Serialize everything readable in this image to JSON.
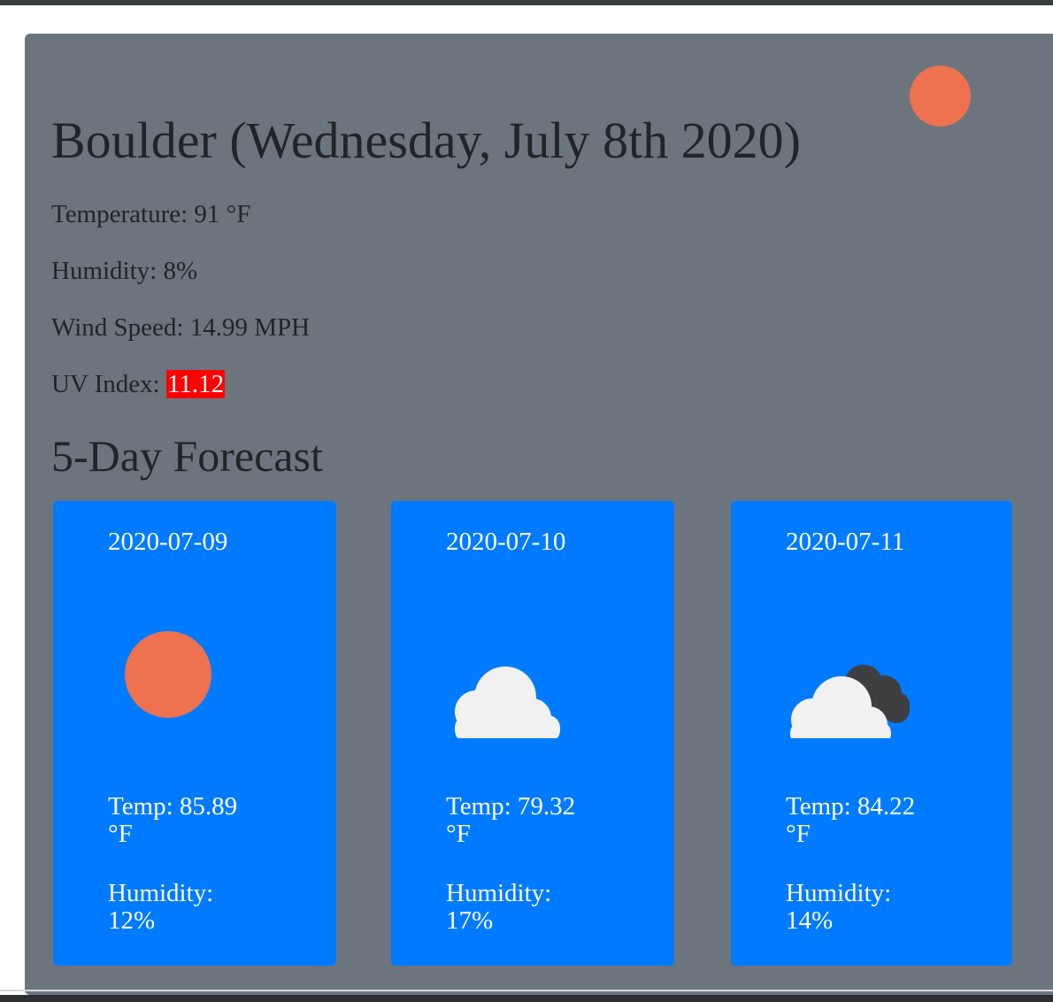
{
  "current": {
    "title": "Boulder (Wednesday, July 8th 2020)",
    "icon": "sun-icon",
    "temperature_label": "Temperature: 91 °F",
    "humidity_label": "Humidity: 8%",
    "wind_label": "Wind Speed: 14.99 MPH",
    "uv_prefix": "UV Index: ",
    "uv_value": "11.12",
    "uv_color": "#ff0000",
    "sun_color": "#ee7150"
  },
  "forecast": {
    "title": "5-Day Forecast",
    "card_color": "#007bff",
    "days": [
      {
        "date": "2020-07-09",
        "icon": "sun-icon",
        "temp_line1": "Temp: 85.89",
        "temp_line2": "°F",
        "hum_line1": "Humidity:",
        "hum_line2": "12%"
      },
      {
        "date": "2020-07-10",
        "icon": "cloud-icon",
        "temp_line1": "Temp: 79.32",
        "temp_line2": "°F",
        "hum_line1": "Humidity:",
        "hum_line2": "17%"
      },
      {
        "date": "2020-07-11",
        "icon": "broken-clouds-icon",
        "temp_line1": "Temp: 84.22",
        "temp_line2": "°F",
        "hum_line1": "Humidity:",
        "hum_line2": "14%"
      }
    ]
  },
  "panel_color": "#6c757d"
}
